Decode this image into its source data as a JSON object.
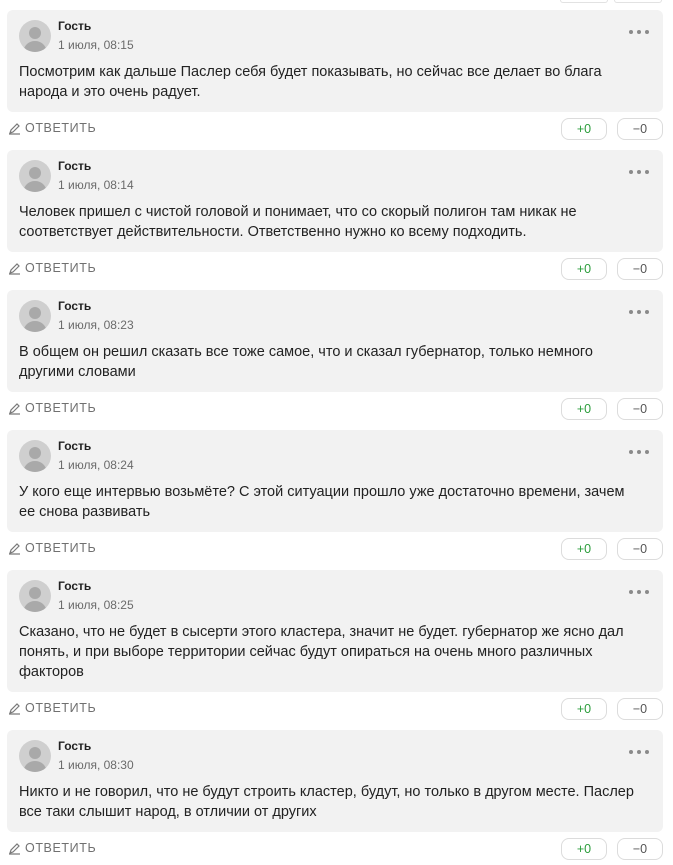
{
  "reply_label": "ОТВЕТИТЬ",
  "comments": [
    {
      "author": "Гость",
      "date": "1 июля, 08:15",
      "text": "Посмотрим как дальше Паслер себя будет показывать, но сейчас все делает во блага народа и это очень радует.",
      "likes": "+0",
      "dislikes": "−0"
    },
    {
      "author": "Гость",
      "date": "1 июля, 08:14",
      "text": "Человек пришел с чистой головой и понимает, что со скорый полигон там никак не соответствует действительности. Ответственно нужно ко всему подходить.",
      "likes": "+0",
      "dislikes": "−0"
    },
    {
      "author": "Гость",
      "date": "1 июля, 08:23",
      "text": "В общем он решил сказать все тоже самое, что и сказал губернатор, только немного другими словами",
      "likes": "+0",
      "dislikes": "−0"
    },
    {
      "author": "Гость",
      "date": "1 июля, 08:24",
      "text": "У кого еще интервью возьмёте? С этой ситуации прошло уже достаточно времени, зачем ее снова развивать",
      "likes": "+0",
      "dislikes": "−0"
    },
    {
      "author": "Гость",
      "date": "1 июля, 08:25",
      "text": "Сказано, что не будет в сысерти этого кластера, значит не будет. губернатор же ясно дал понять, и при выборе территории сейчас будут опираться на очень много различных факторов",
      "likes": "+0",
      "dislikes": "−0"
    },
    {
      "author": "Гость",
      "date": "1 июля, 08:30",
      "text": "Никто и не говорил, что не будут строить кластер, будут, но только в другом месте. Паслер все таки слышит народ, в отличии от других",
      "likes": "+0",
      "dislikes": "−0"
    }
  ]
}
